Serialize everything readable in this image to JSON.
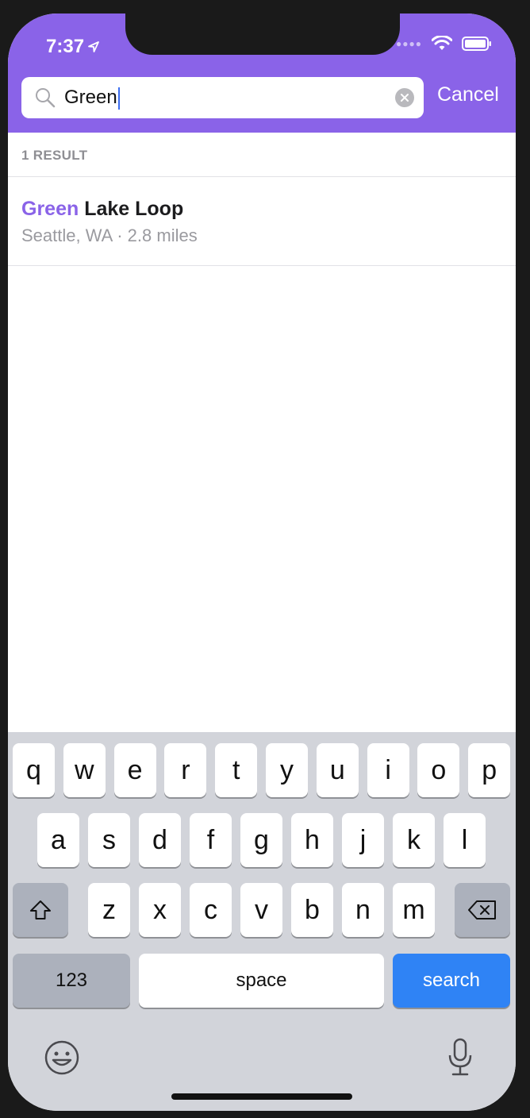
{
  "status": {
    "time": "7:37"
  },
  "search": {
    "value": "Green",
    "cancel_label": "Cancel"
  },
  "results": {
    "count_label": "1 RESULT",
    "items": [
      {
        "highlight": "Green",
        "rest": " Lake Loop",
        "subtitle": "Seattle, WA · 2.8 miles"
      }
    ]
  },
  "keyboard": {
    "row1": [
      "q",
      "w",
      "e",
      "r",
      "t",
      "y",
      "u",
      "i",
      "o",
      "p"
    ],
    "row2": [
      "a",
      "s",
      "d",
      "f",
      "g",
      "h",
      "j",
      "k",
      "l"
    ],
    "row3": [
      "z",
      "x",
      "c",
      "v",
      "b",
      "n",
      "m"
    ],
    "numbers_label": "123",
    "space_label": "space",
    "search_label": "search"
  },
  "colors": {
    "accent": "#8a63e8",
    "search_key": "#2f83f5"
  }
}
